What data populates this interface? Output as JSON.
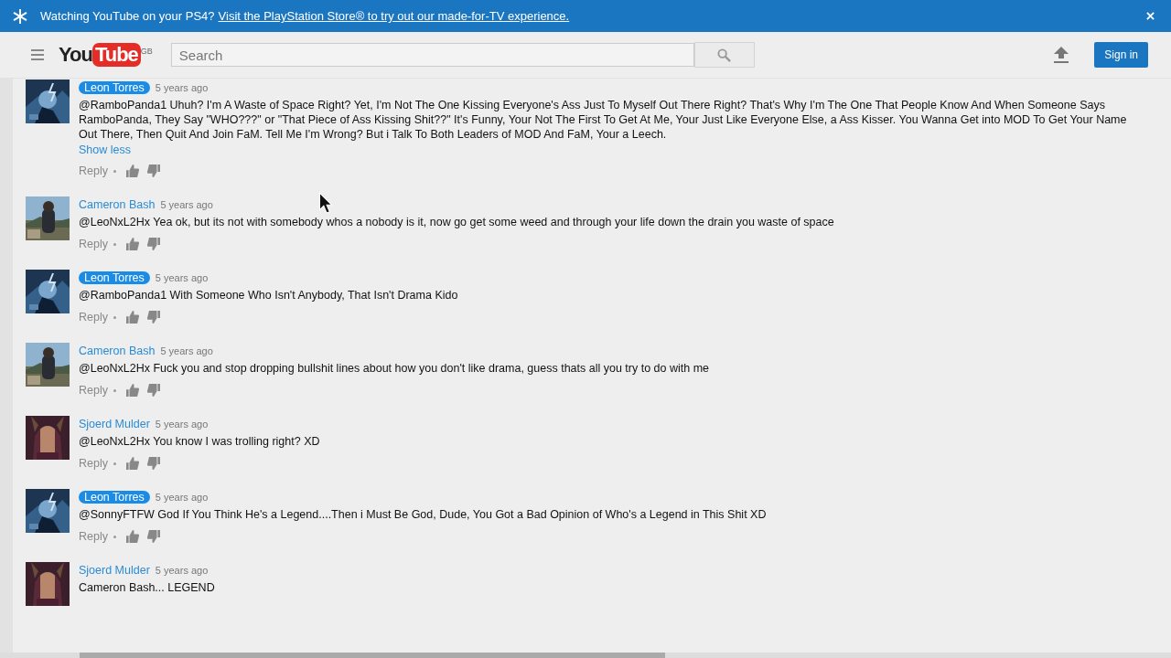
{
  "banner": {
    "text": "Watching YouTube on your PS4?",
    "link": "Visit the PlayStation Store® to try out our made-for-TV experience."
  },
  "header": {
    "logo_you": "You",
    "logo_tube": "Tube",
    "region": "GB",
    "search": {
      "placeholder": "Search"
    },
    "sign_in": "Sign in"
  },
  "comments": [
    {
      "author": "Leon Torres",
      "highlighted": true,
      "time": "5 years ago",
      "text": "@RamboPanda1 Uhuh? I'm A Waste of Space Right? Yet, I'm Not The One Kissing Everyone's Ass Just To Myself Out There Right? That's Why I'm The One That People Know And When Someone Says RamboPanda, They Say \"WHO???\" or \"That Piece of Ass Kissing Shit??\" It's Funny, Your Not The First To Get At Me, Your Just Like Everyone Else, a Ass Kisser.  You Wanna Get into MOD To Get Your Name Out There, Then Quit And Join FaM.  Tell Me I'm Wrong?  But i Talk To Both Leaders of MOD And FaM, Your a Leech.",
      "toggle": "Show less",
      "reply": "Reply"
    },
    {
      "author": "Cameron Bash",
      "highlighted": false,
      "time": "5 years ago",
      "text": "@LeoNxL2Hx Yea ok, but its not with somebody whos a nobody is it, now go get some weed and through your life down the drain you waste of space",
      "reply": "Reply"
    },
    {
      "author": "Leon Torres",
      "highlighted": true,
      "time": "5 years ago",
      "text": "@RamboPanda1 With Someone Who Isn't Anybody, That Isn't Drama Kido",
      "reply": "Reply"
    },
    {
      "author": "Cameron Bash",
      "highlighted": false,
      "time": "5 years ago",
      "text": "@LeoNxL2Hx Fuck you and stop dropping bullshit lines about how you don't like drama, guess thats all you try to do with me",
      "reply": "Reply"
    },
    {
      "author": "Sjoerd Mulder",
      "highlighted": false,
      "time": "5 years ago",
      "text": "@LeoNxL2Hx You know I was trolling right? XD",
      "reply": "Reply"
    },
    {
      "author": "Leon Torres",
      "highlighted": true,
      "time": "5 years ago",
      "text": "@SonnyFTFW God If You Think He's a Legend....Then i Must Be God, Dude, You Got a Bad Opinion of Who's a Legend in This Shit XD",
      "reply": "Reply"
    },
    {
      "author": "Sjoerd Mulder",
      "highlighted": false,
      "time": "5 years ago",
      "text": "Cameron Bash... LEGEND"
    }
  ]
}
